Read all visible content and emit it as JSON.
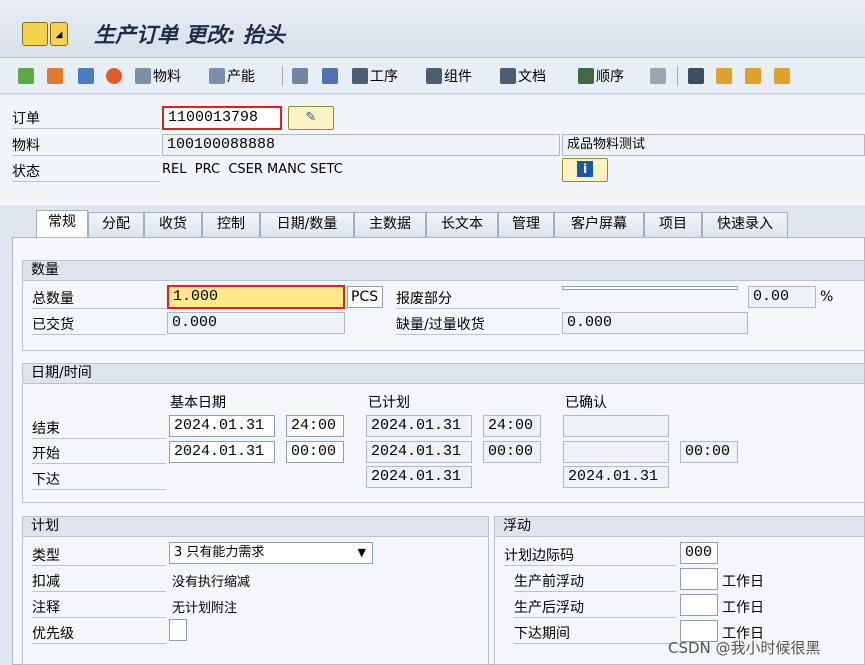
{
  "title": "生产订单 更改: 抬头",
  "toolbar": {
    "material": "物料",
    "capacity": "产能",
    "operation": "工序",
    "component": "组件",
    "document": "文档",
    "sequence": "顺序"
  },
  "header": {
    "order_label": "订单",
    "order_value": "1100013798",
    "material_label": "物料",
    "material_value": "100100088888",
    "material_desc": "成品物料测试",
    "status_label": "状态",
    "status_value": "REL  PRC  CSER MANC SETC"
  },
  "tabs": [
    "常规",
    "分配",
    "收货",
    "控制",
    "日期/数量",
    "主数据",
    "长文本",
    "管理",
    "客户屏幕",
    "项目",
    "快速录入"
  ],
  "quantity": {
    "title": "数量",
    "total_label": "总数量",
    "total_value": "1.000",
    "unit": "PCS",
    "scrap_label": "报废部分",
    "scrap_value": "",
    "scrap_pct": "0.00",
    "pct_sign": "%",
    "delivered_label": "已交货",
    "delivered_value": "0.000",
    "short_label": "缺量/过量收货",
    "short_value": "0.000"
  },
  "dates": {
    "title": "日期/时间",
    "col_basic": "基本日期",
    "col_planned": "已计划",
    "col_confirmed": "已确认",
    "end_label": "结束",
    "end_basic_date": "2024.01.31",
    "end_basic_time": "24:00",
    "end_plan_date": "2024.01.31",
    "end_plan_time": "24:00",
    "start_label": "开始",
    "start_basic_date": "2024.01.31",
    "start_basic_time": "00:00",
    "start_plan_date": "2024.01.31",
    "start_plan_time": "00:00",
    "start_conf_time": "00:00",
    "release_label": "下达",
    "release_plan_date": "2024.01.31",
    "release_conf_date": "2024.01.31"
  },
  "plan": {
    "title": "计划",
    "type_label": "类型",
    "type_value": "3 只有能力需求",
    "deduct_label": "扣减",
    "deduct_value": "没有执行缩减",
    "note_label": "注释",
    "note_value": "无计划附注",
    "priority_label": "优先级",
    "priority_value": ""
  },
  "float": {
    "title": "浮动",
    "margin_label": "计划边际码",
    "margin_value": "000",
    "before_label": "生产前浮动",
    "before_value": "",
    "after_label": "生产后浮动",
    "after_value": "",
    "release_label": "下达期间",
    "release_value": "",
    "unit": "工作日"
  },
  "watermark": "CSDN @我小时候很黑"
}
